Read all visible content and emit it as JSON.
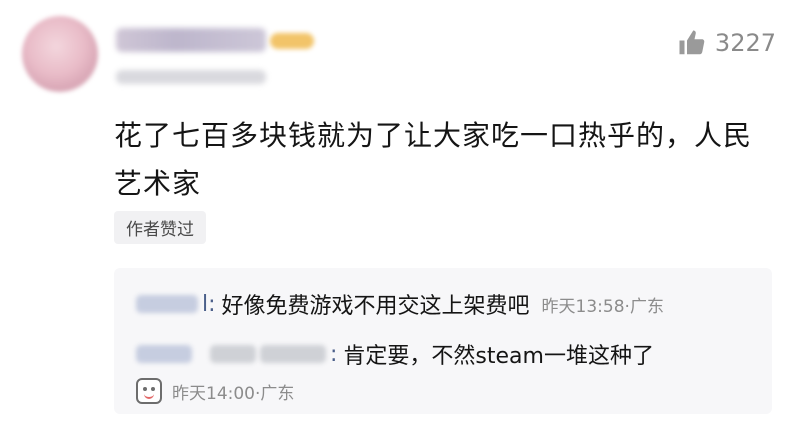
{
  "post": {
    "likes": "3227",
    "comment": "花了七百多块钱就为了让大家吃一口热乎的，人民艺术家",
    "author_liked_tag": "作者赞过"
  },
  "replies": [
    {
      "user_suffix": "l:",
      "text": "好像免费游戏不用交这上架费吧",
      "time": "昨天13:58",
      "location": "·广东"
    },
    {
      "reply_to_suffix": ":",
      "text": "肯定要，不然steam一堆这种了"
    }
  ],
  "footer": {
    "time": "昨天14:00",
    "location": "·广东"
  },
  "icons": {
    "like": "thumbs-up-icon",
    "emoji": "emoji-face-icon"
  }
}
